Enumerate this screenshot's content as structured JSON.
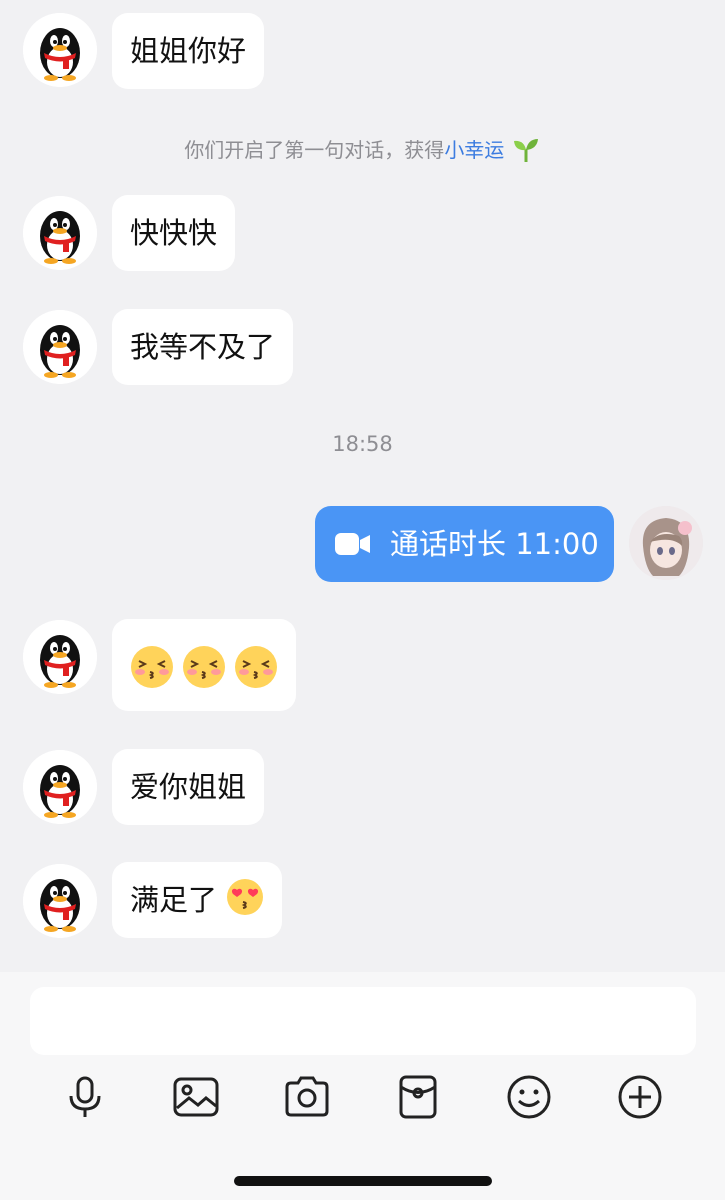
{
  "messages": {
    "m1": "姐姐你好",
    "m2": "快快快",
    "m3": "我等不及了",
    "m4": "爱你姐姐",
    "m5": "满足了"
  },
  "system_notice": {
    "prefix": "你们开启了第一句对话，获得",
    "highlight": "小幸运"
  },
  "timestamp": "18:58",
  "call": {
    "label": "通话时长 11:00"
  },
  "input": {
    "placeholder": ""
  },
  "toolbar": {
    "icons": [
      "microphone-icon",
      "image-icon",
      "camera-icon",
      "red-packet-icon",
      "emoji-icon",
      "plus-icon"
    ]
  },
  "colors": {
    "background": "#f1f1f3",
    "bubble": "#ffffff",
    "outgoing_bubble": "#4a95f5",
    "highlight": "#3c7ce0"
  }
}
